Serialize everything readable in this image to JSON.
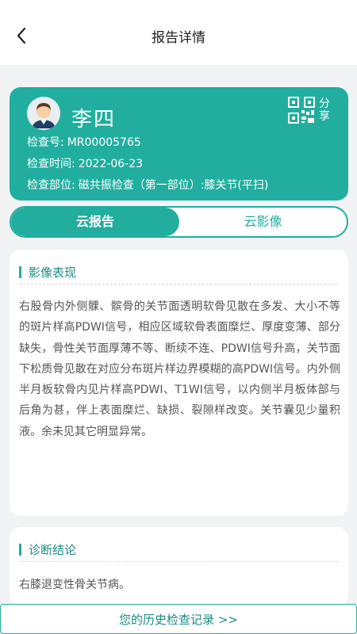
{
  "header": {
    "title": "报告详情",
    "back_icon": "chevron-left-icon"
  },
  "patient": {
    "name": "李四",
    "avatar_icon": "user-avatar-icon",
    "share_label": "分享",
    "share_icon": "qr-code-icon",
    "exam_no_label": "检查号:",
    "exam_no": "MR00005765",
    "exam_time_label": "检查时间:",
    "exam_time": "2022-06-23",
    "exam_part_label": "检查部位:",
    "exam_part": "磁共振检查（第一部位）:膝关节(平扫)"
  },
  "tabs": [
    {
      "label": "云报告",
      "active": true
    },
    {
      "label": "云影像",
      "active": false
    }
  ],
  "findings": {
    "title": "影像表现",
    "text": "右股骨内外侧髁、髌骨的关节面透明软骨见散在多发、大小不等的斑片样高PDWI信号，相应区域软骨表面糜烂、厚度变薄、部分缺失，骨性关节面厚薄不等、断续不连、PDWI信号升高，关节面下松质骨见散在对应分布斑片样边界模糊的高PDWI信号。内外侧半月板软骨内见片样高PDWI、T1WI信号，以内侧半月板体部与后角为甚，伴上表面糜烂、缺损、裂隙样改变。关节囊见少量积液。余未见其它明显异常。"
  },
  "diagnosis": {
    "title": "诊断结论",
    "text": "右膝退变性骨关节病。"
  },
  "history_link": "您的历史检查记录 >>",
  "colors": {
    "accent": "#21ae9e",
    "accent_text": "#1a8c80",
    "background": "#f2f3f5"
  }
}
